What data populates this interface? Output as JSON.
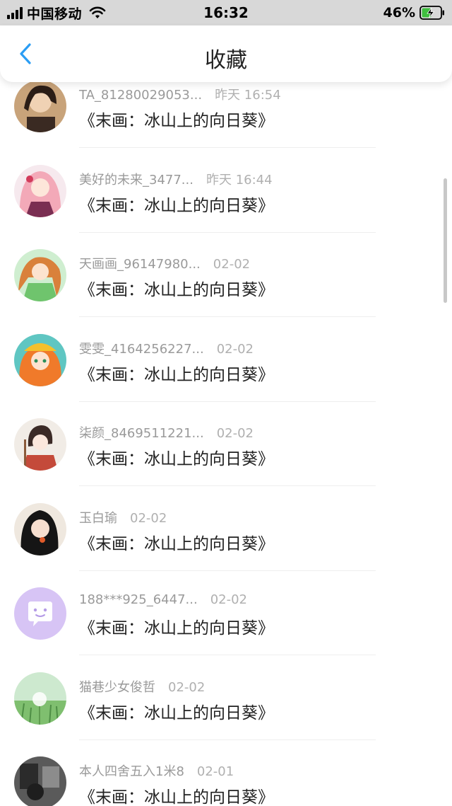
{
  "status_bar": {
    "carrier": "中国移动",
    "time": "16:32",
    "battery": "46%"
  },
  "header": {
    "title": "收藏"
  },
  "favorites": [
    {
      "user": "TA_81280029053...",
      "date": "昨天 16:54",
      "title": "《末画：冰山上的向日葵》"
    },
    {
      "user": "美好的未来_3477...",
      "date": "昨天 16:44",
      "title": "《末画：冰山上的向日葵》"
    },
    {
      "user": "天画画_96147980...",
      "date": "02-02",
      "title": "《末画：冰山上的向日葵》"
    },
    {
      "user": "雯雯_4164256227...",
      "date": "02-02",
      "title": "《末画：冰山上的向日葵》"
    },
    {
      "user": "柒颜_8469511221...",
      "date": "02-02",
      "title": "《末画：冰山上的向日葵》"
    },
    {
      "user": "玉白瑜",
      "date": "02-02",
      "title": "《末画：冰山上的向日葵》"
    },
    {
      "user": "188***925_6447...",
      "date": "02-02",
      "title": "《末画：冰山上的向日葵》"
    },
    {
      "user": "猫巷少女俊哲",
      "date": "02-02",
      "title": "《末画：冰山上的向日葵》"
    },
    {
      "user": "本人四舍五入1米8",
      "date": "02-01",
      "title": "《末画：冰山上的向日葵》"
    }
  ],
  "colors": {
    "accent": "#2a9df4",
    "battery_charging": "#3fbf3f",
    "default_avatar": "#d7c4f5"
  }
}
